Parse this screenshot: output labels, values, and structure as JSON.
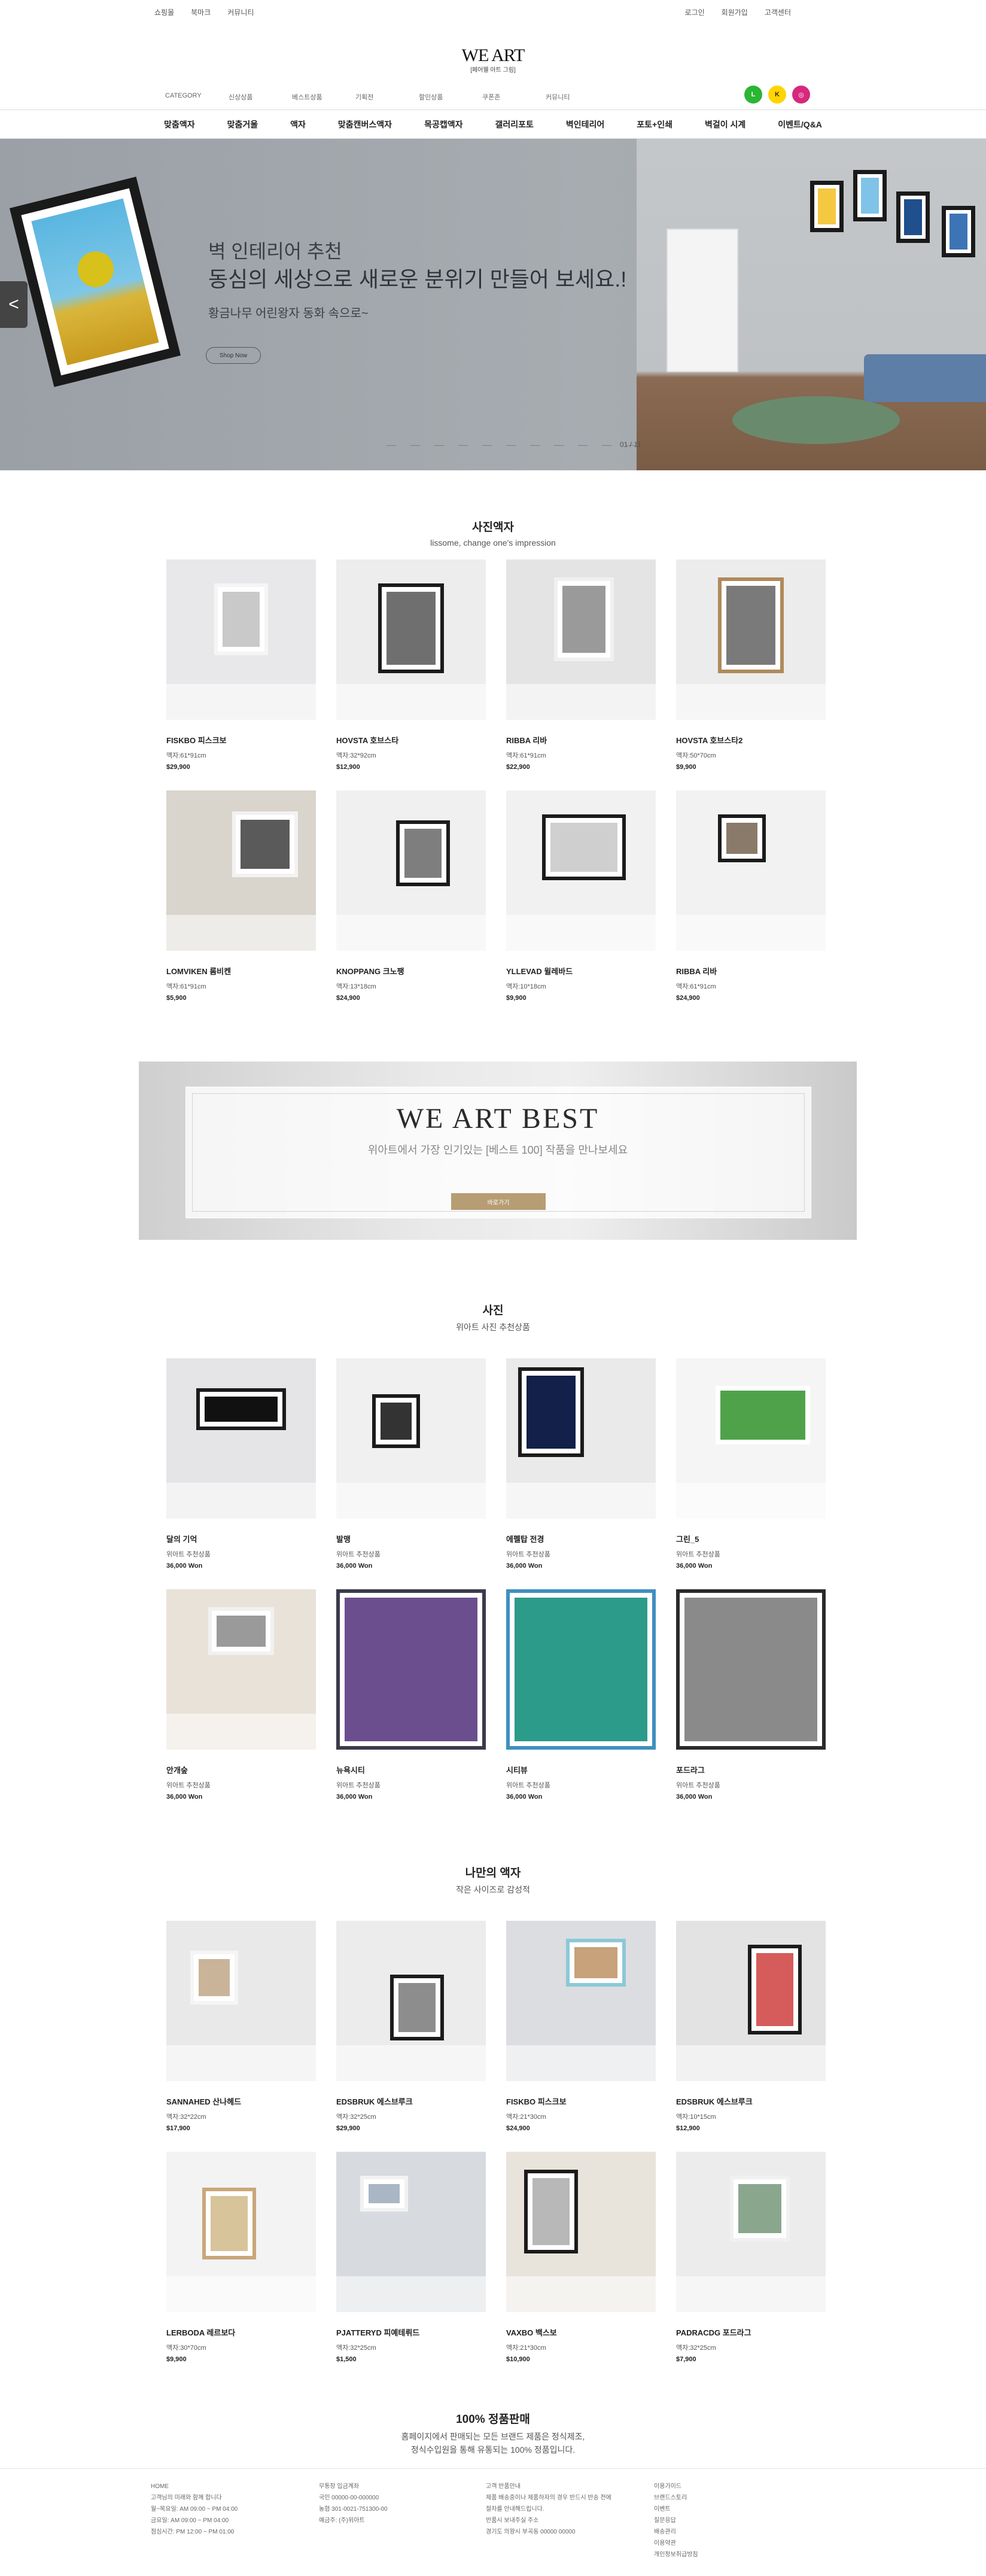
{
  "topbar": {
    "left": [
      "쇼핑몰",
      "북마크",
      "커뮤니티"
    ],
    "right": [
      "로그인",
      "회원가입",
      "고객센터"
    ]
  },
  "logo": {
    "title": "WE ART",
    "subtitle": "[페어웰 아트 그림]"
  },
  "subnav": [
    "CATEGORY",
    "신상상품",
    "베스트상품",
    "기획전",
    "할인상품",
    "쿠폰존",
    "커뮤니티"
  ],
  "sns": [
    {
      "name": "line-icon",
      "label": "L",
      "color": "#2bb534"
    },
    {
      "name": "kakao-icon",
      "label": "K",
      "color": "#ffd400"
    },
    {
      "name": "instagram-icon",
      "label": "◎",
      "color": "#d6287d"
    }
  ],
  "mainnav": [
    "맞춤액자",
    "맞춤거울",
    "액자",
    "맞춤캔버스액자",
    "목공캡액자",
    "갤러리포토",
    "벽인테리어",
    "포토+인쇄",
    "벽걸이 시계",
    "이벤트/Q&A"
  ],
  "hero": {
    "title1": "벽 인테리어 추천",
    "title2": "동심의 세상으로 새로운 분위기 만들어 보세요.!",
    "subtitle": "황금나무 어린왕자 동화 속으로~",
    "button": "Shop Now",
    "prev_arrow": "<",
    "counter": "01 / 11"
  },
  "section1": {
    "title": "사진액자",
    "subtitle": "lissome, change one's impression",
    "items": [
      {
        "name": "FISKBO 피스크보",
        "size": "액자:61*91cm",
        "price": "$29,900"
      },
      {
        "name": "HOVSTA 호브스타",
        "size": "액자:32*92cm",
        "price": "$12,900"
      },
      {
        "name": "RIBBA 리바",
        "size": "액자:61*91cm",
        "price": "$22,900"
      },
      {
        "name": "HOVSTA 호브스타2",
        "size": "액자:50*70cm",
        "price": "$9,900"
      },
      {
        "name": "LOMVIKEN 롬비켄",
        "size": "액자:61*91cm",
        "price": "$5,900"
      },
      {
        "name": "KNOPPANG 크노팽",
        "size": "액자:13*18cm",
        "price": "$24,900"
      },
      {
        "name": "YLLEVAD 윌레바드",
        "size": "액자:10*18cm",
        "price": "$9,900"
      },
      {
        "name": "RIBBA 리바",
        "size": "액자:61*91cm",
        "price": "$24,900"
      }
    ]
  },
  "banner": {
    "title": "WE ART BEST",
    "subtitle": "위아트에서 가장 인기있는 [베스트 100] 작품을 만나보세요",
    "button": "바로가기"
  },
  "section2": {
    "title": "사진",
    "subtitle": "위아트 사진 추천상품",
    "items": [
      {
        "name": "달의 기억",
        "size": "위아트 추천상품",
        "price": "36,000 Won"
      },
      {
        "name": "발맹",
        "size": "위아트 추천상품",
        "price": "36,000 Won"
      },
      {
        "name": "에펠탑 전경",
        "size": "위아트 추천상품",
        "price": "36,000 Won"
      },
      {
        "name": "그린_5",
        "size": "위아트 추천상품",
        "price": "36,000 Won"
      },
      {
        "name": "안개숲",
        "size": "위아트 추천상품",
        "price": "36,000 Won"
      },
      {
        "name": "뉴욕시티",
        "size": "위아트 추천상품",
        "price": "36,000 Won"
      },
      {
        "name": "시티뷰",
        "size": "위아트 추천상품",
        "price": "36,000 Won"
      },
      {
        "name": "포드라그",
        "size": "위아트 추천상품",
        "price": "36,000 Won"
      }
    ]
  },
  "section3": {
    "title": "나만의 액자",
    "subtitle": "작은 사이즈로 감성적",
    "items": [
      {
        "name": "SANNAHED 산나헤드",
        "size": "액자:32*22cm",
        "price": "$17,900"
      },
      {
        "name": "EDSBRUK 에스브루크",
        "size": "액자:32*25cm",
        "price": "$29,900"
      },
      {
        "name": "FISKBO 피스크보",
        "size": "액자:21*30cm",
        "price": "$24,900"
      },
      {
        "name": "EDSBRUK 에스브루크",
        "size": "액자:10*15cm",
        "price": "$12,900"
      },
      {
        "name": "LERBODA 레르보다",
        "size": "액자:30*70cm",
        "price": "$9,900"
      },
      {
        "name": "PJATTERYD 피예테뤼드",
        "size": "액자:32*25cm",
        "price": "$1,500"
      },
      {
        "name": "VAXBO 백스보",
        "size": "액자:21*30cm",
        "price": "$10,900"
      },
      {
        "name": "PADRACDG 포드라그",
        "size": "액자:32*25cm",
        "price": "$7,900"
      }
    ]
  },
  "guarantee": {
    "title": "100% 정품판매",
    "line1": "홈페이지에서 판매되는 모든 브랜드 제품은 정식제조,",
    "line2": "정식수입원을 통해 유통되는 100% 정품입니다."
  },
  "footer": {
    "col1": [
      "HOME",
      "고객님의 미래와 함께 합니다",
      "월~목요일: AM 09:00 ~ PM 04:00",
      "금요일: AM 09:00 ~ PM 04:00",
      "점심시간: PM 12:00 ~ PM 01:00"
    ],
    "col2": [
      "무통장 입금계좌",
      "국민 00000-00-000000",
      "농협 301-0021-751300-00",
      "예금주: (주)위아트"
    ],
    "col3": [
      "고객 반품안내",
      "제품 배송중이나 제품하자의 경우 반드시 반송 전에",
      "절차를 안내해드립니다.",
      "반품시 보내주실 주소",
      "경기도 의왕시 부곡동 00000 00000"
    ],
    "col4": [
      "이용가이드",
      "브랜드스토리",
      "이벤트",
      "질문응답",
      "배송관리",
      "이용약관",
      "개인정보취급방침"
    ]
  },
  "colors": {
    "accent": "#b79d73",
    "text": "#222222",
    "nav_border": "#dddddd"
  }
}
